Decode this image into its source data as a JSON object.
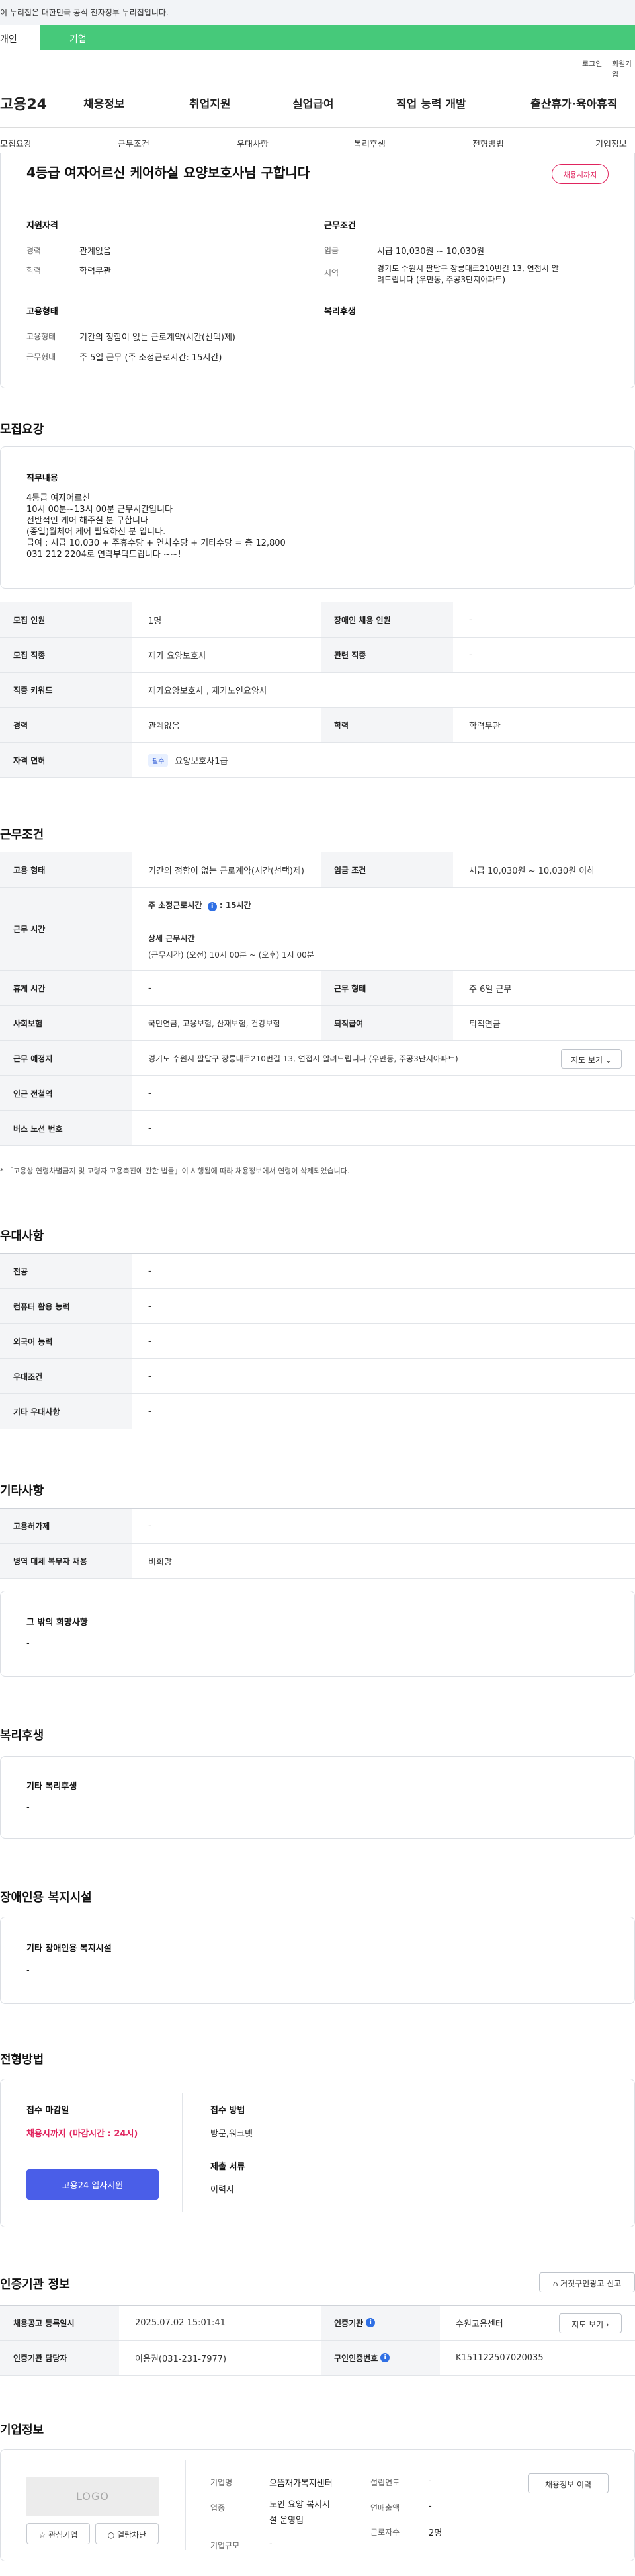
{
  "gov_bar": {
    "text": "이 누리집은 대한민국 공식 전자정부 누리집입니다."
  },
  "top_tabs": {
    "personal": "개인",
    "corporate": "기업"
  },
  "util": {
    "login": "로그인",
    "join": "회원가입"
  },
  "logo": "고용24",
  "gnb": [
    "채용정보",
    "취업지원",
    "실업급여",
    "직업 능력 개발",
    "출산휴가·육아휴직"
  ],
  "snb": [
    "모집요강",
    "근무조건",
    "우대사항",
    "복리후생",
    "전형방법",
    "기업정보"
  ],
  "summary": {
    "title": "4등급 여자어르신 케어하실 요양보호사님 구합니다",
    "badge": "채용시까지",
    "qual_title": "지원자격",
    "career_label": "경력",
    "career_value": "관계없음",
    "edu_label": "학력",
    "edu_value": "학력무관",
    "cond_title": "근무조건",
    "wage_label": "임금",
    "wage_value": "시급 10,030원 ~ 10,030원",
    "area_label": "지역",
    "area_value_1": "경기도 수원시 팔달구 장릉대로210번길 13, 연접시 알",
    "area_value_2": "려드립니다 (우만동, 주공3단지아파트)",
    "emp_title": "고용형태",
    "emp_type_label": "고용형태",
    "emp_type_value": "기간의 정함이 없는 근로계약(시간(선택)제)",
    "work_type_label": "근무형태",
    "work_type_value": "주 5일 근무 (주 소정근로시간: 15시간)",
    "welfare_title": "복리후생"
  },
  "recruit": {
    "section_title": "모집요강",
    "job_content_title": "직무내용",
    "job_content_lines": [
      "4등급 여자어르신",
      "10시 00분~13시 00분 근무시간입니다",
      "전반적인 케어 해주실 분 구합니다",
      "(종일)월체어 케어 필요하신 분 입니다.",
      "급여 : 시급 10,030 + 주휴수당 + 연차수당 + 기타수당 = 총 12,800",
      "031 212 2204로 연락부탁드립니다 ~~!"
    ],
    "rows": [
      {
        "h1": "모집 인원",
        "v1": "1명",
        "h2": "장애인 채용 인원",
        "v2": "-"
      },
      {
        "h1": "모집 직종",
        "v1": "재가 요양보호사",
        "h2": "관련 직종",
        "v2": "-"
      },
      {
        "h1": "직종 키워드",
        "v1": "재가요양보호사 , 재가노인요양사"
      },
      {
        "h1": "경력",
        "v1": "관계없음",
        "h2": "학력",
        "v2": "학력무관"
      },
      {
        "h1": "자격 면허",
        "chip": "필수",
        "v1": "요양보호사1급"
      }
    ]
  },
  "conditions": {
    "section_title": "근무조건",
    "emp_type_h": "고용 형태",
    "emp_type_v": "기간의 정함이 없는 근로계약(시간(선택)제)",
    "wage_h": "임금 조건",
    "wage_v": "시급 10,030원 ~ 10,030원 이하",
    "hours_h": "근무 시간",
    "hours_weekly_label": "주 소정근로시간",
    "hours_weekly_value": ": 15시간",
    "hours_detail_label": "상세 근무시간",
    "hours_detail_value": "(근무시간) (오전) 10시 00분 ~ (오후) 1시 00분",
    "holiday_h": "휴게 시간",
    "holiday_v": "-",
    "work_form_h": "근무 형태",
    "work_form_v": "주 6일 근무",
    "insurance_h": "사회보험",
    "insurance_v": "국민연금, 고용보험, 산재보험, 건강보험",
    "severance_h": "퇴직급여",
    "severance_v": "퇴직연금",
    "location_h": "근무 예정지",
    "location_v": "경기도 수원시 팔달구 장릉대로210번길 13, 연접시 알려드립니다 (우만동, 주공3단지아파트)",
    "map_btn": "지도 보기",
    "subway_h": "인근 전철역",
    "subway_v": "-",
    "bus_h": "버스 노선 번호",
    "bus_v": "-",
    "note": "* 「고용상 연령차별금지 및 고령자 고용촉진에 관한 법률」이 시행됨에 따라 채용정보에서 연령이 삭제되었습니다."
  },
  "preference": {
    "section_title": "우대사항",
    "rows": [
      {
        "h": "전공",
        "v": "-"
      },
      {
        "h": "컴퓨터 활용 능력",
        "v": "-"
      },
      {
        "h": "외국어 능력",
        "v": "-"
      },
      {
        "h": "우대조건",
        "v": "-"
      },
      {
        "h": "기타 우대사항",
        "v": "-"
      }
    ]
  },
  "etc": {
    "section_title": "기타사항",
    "rows": [
      {
        "h": "고용허가제",
        "v": "-"
      },
      {
        "h": "병역 대체 복무자 채용",
        "v": "비희망"
      }
    ],
    "other_title": "그 밖의 희망사항",
    "other_value": "-"
  },
  "welfare": {
    "section_title": "복리후생",
    "box_title": "기타 복리후생",
    "box_value": "-"
  },
  "disability": {
    "section_title": "장애인용 복지시설",
    "box_title": "기타 장애인용 복지시설",
    "box_value": "-"
  },
  "screening": {
    "section_title": "전형방법",
    "deadline_label": "접수 마감일",
    "deadline_value": "채용시까지 (마감시간 : 24시)",
    "apply_btn": "고용24 입사지원",
    "method_label": "접수 방법",
    "method_value": "방문,워크넷",
    "docs_label": "제출 서류",
    "docs_value": "이력서"
  },
  "agency": {
    "section_title": "인증기관 정보",
    "report_btn": "거짓구인광고 신고",
    "reg_date_h": "채용공고 등록일시",
    "reg_date_v": "2025.07.02 15:01:41",
    "agency_h": "인증기관",
    "agency_v": "수원고용센터",
    "map_btn": "지도 보기",
    "manager_h": "인증기관 담당자",
    "manager_v": "이용권(031-231-7977)",
    "auth_no_h": "구인인증번호",
    "auth_no_v": "K151122507020035"
  },
  "company": {
    "section_title": "기업정보",
    "logo_text": "LOGO",
    "fav_btn": "관심기업",
    "block_btn": "열람차단",
    "name_label": "기업명",
    "name_value": "으뜸재가복지센터",
    "biz_label": "업종",
    "biz_value_1": "노인 요양 복지시",
    "biz_value_2": "설 운영업",
    "size_label": "기업규모",
    "size_value": "-",
    "founded_label": "설립연도",
    "founded_value": "-",
    "revenue_label": "연매출액",
    "revenue_value": "-",
    "employees_label": "근로자수",
    "employees_value": "2명",
    "history_btn": "채용정보 이력"
  }
}
